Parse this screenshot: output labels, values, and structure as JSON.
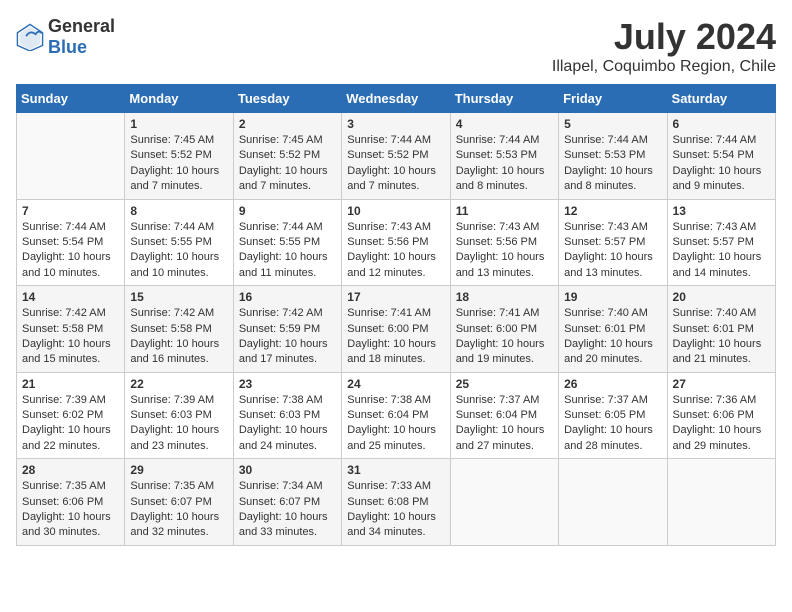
{
  "logo": {
    "general": "General",
    "blue": "Blue"
  },
  "title": {
    "month_year": "July 2024",
    "location": "Illapel, Coquimbo Region, Chile"
  },
  "days_of_week": [
    "Sunday",
    "Monday",
    "Tuesday",
    "Wednesday",
    "Thursday",
    "Friday",
    "Saturday"
  ],
  "weeks": [
    [
      {
        "day": "",
        "sunrise": "",
        "sunset": "",
        "daylight": ""
      },
      {
        "day": "1",
        "sunrise": "Sunrise: 7:45 AM",
        "sunset": "Sunset: 5:52 PM",
        "daylight": "Daylight: 10 hours and 7 minutes."
      },
      {
        "day": "2",
        "sunrise": "Sunrise: 7:45 AM",
        "sunset": "Sunset: 5:52 PM",
        "daylight": "Daylight: 10 hours and 7 minutes."
      },
      {
        "day": "3",
        "sunrise": "Sunrise: 7:44 AM",
        "sunset": "Sunset: 5:52 PM",
        "daylight": "Daylight: 10 hours and 7 minutes."
      },
      {
        "day": "4",
        "sunrise": "Sunrise: 7:44 AM",
        "sunset": "Sunset: 5:53 PM",
        "daylight": "Daylight: 10 hours and 8 minutes."
      },
      {
        "day": "5",
        "sunrise": "Sunrise: 7:44 AM",
        "sunset": "Sunset: 5:53 PM",
        "daylight": "Daylight: 10 hours and 8 minutes."
      },
      {
        "day": "6",
        "sunrise": "Sunrise: 7:44 AM",
        "sunset": "Sunset: 5:54 PM",
        "daylight": "Daylight: 10 hours and 9 minutes."
      }
    ],
    [
      {
        "day": "7",
        "sunrise": "Sunrise: 7:44 AM",
        "sunset": "Sunset: 5:54 PM",
        "daylight": "Daylight: 10 hours and 10 minutes."
      },
      {
        "day": "8",
        "sunrise": "Sunrise: 7:44 AM",
        "sunset": "Sunset: 5:55 PM",
        "daylight": "Daylight: 10 hours and 10 minutes."
      },
      {
        "day": "9",
        "sunrise": "Sunrise: 7:44 AM",
        "sunset": "Sunset: 5:55 PM",
        "daylight": "Daylight: 10 hours and 11 minutes."
      },
      {
        "day": "10",
        "sunrise": "Sunrise: 7:43 AM",
        "sunset": "Sunset: 5:56 PM",
        "daylight": "Daylight: 10 hours and 12 minutes."
      },
      {
        "day": "11",
        "sunrise": "Sunrise: 7:43 AM",
        "sunset": "Sunset: 5:56 PM",
        "daylight": "Daylight: 10 hours and 13 minutes."
      },
      {
        "day": "12",
        "sunrise": "Sunrise: 7:43 AM",
        "sunset": "Sunset: 5:57 PM",
        "daylight": "Daylight: 10 hours and 13 minutes."
      },
      {
        "day": "13",
        "sunrise": "Sunrise: 7:43 AM",
        "sunset": "Sunset: 5:57 PM",
        "daylight": "Daylight: 10 hours and 14 minutes."
      }
    ],
    [
      {
        "day": "14",
        "sunrise": "Sunrise: 7:42 AM",
        "sunset": "Sunset: 5:58 PM",
        "daylight": "Daylight: 10 hours and 15 minutes."
      },
      {
        "day": "15",
        "sunrise": "Sunrise: 7:42 AM",
        "sunset": "Sunset: 5:58 PM",
        "daylight": "Daylight: 10 hours and 16 minutes."
      },
      {
        "day": "16",
        "sunrise": "Sunrise: 7:42 AM",
        "sunset": "Sunset: 5:59 PM",
        "daylight": "Daylight: 10 hours and 17 minutes."
      },
      {
        "day": "17",
        "sunrise": "Sunrise: 7:41 AM",
        "sunset": "Sunset: 6:00 PM",
        "daylight": "Daylight: 10 hours and 18 minutes."
      },
      {
        "day": "18",
        "sunrise": "Sunrise: 7:41 AM",
        "sunset": "Sunset: 6:00 PM",
        "daylight": "Daylight: 10 hours and 19 minutes."
      },
      {
        "day": "19",
        "sunrise": "Sunrise: 7:40 AM",
        "sunset": "Sunset: 6:01 PM",
        "daylight": "Daylight: 10 hours and 20 minutes."
      },
      {
        "day": "20",
        "sunrise": "Sunrise: 7:40 AM",
        "sunset": "Sunset: 6:01 PM",
        "daylight": "Daylight: 10 hours and 21 minutes."
      }
    ],
    [
      {
        "day": "21",
        "sunrise": "Sunrise: 7:39 AM",
        "sunset": "Sunset: 6:02 PM",
        "daylight": "Daylight: 10 hours and 22 minutes."
      },
      {
        "day": "22",
        "sunrise": "Sunrise: 7:39 AM",
        "sunset": "Sunset: 6:03 PM",
        "daylight": "Daylight: 10 hours and 23 minutes."
      },
      {
        "day": "23",
        "sunrise": "Sunrise: 7:38 AM",
        "sunset": "Sunset: 6:03 PM",
        "daylight": "Daylight: 10 hours and 24 minutes."
      },
      {
        "day": "24",
        "sunrise": "Sunrise: 7:38 AM",
        "sunset": "Sunset: 6:04 PM",
        "daylight": "Daylight: 10 hours and 25 minutes."
      },
      {
        "day": "25",
        "sunrise": "Sunrise: 7:37 AM",
        "sunset": "Sunset: 6:04 PM",
        "daylight": "Daylight: 10 hours and 27 minutes."
      },
      {
        "day": "26",
        "sunrise": "Sunrise: 7:37 AM",
        "sunset": "Sunset: 6:05 PM",
        "daylight": "Daylight: 10 hours and 28 minutes."
      },
      {
        "day": "27",
        "sunrise": "Sunrise: 7:36 AM",
        "sunset": "Sunset: 6:06 PM",
        "daylight": "Daylight: 10 hours and 29 minutes."
      }
    ],
    [
      {
        "day": "28",
        "sunrise": "Sunrise: 7:35 AM",
        "sunset": "Sunset: 6:06 PM",
        "daylight": "Daylight: 10 hours and 30 minutes."
      },
      {
        "day": "29",
        "sunrise": "Sunrise: 7:35 AM",
        "sunset": "Sunset: 6:07 PM",
        "daylight": "Daylight: 10 hours and 32 minutes."
      },
      {
        "day": "30",
        "sunrise": "Sunrise: 7:34 AM",
        "sunset": "Sunset: 6:07 PM",
        "daylight": "Daylight: 10 hours and 33 minutes."
      },
      {
        "day": "31",
        "sunrise": "Sunrise: 7:33 AM",
        "sunset": "Sunset: 6:08 PM",
        "daylight": "Daylight: 10 hours and 34 minutes."
      },
      {
        "day": "",
        "sunrise": "",
        "sunset": "",
        "daylight": ""
      },
      {
        "day": "",
        "sunrise": "",
        "sunset": "",
        "daylight": ""
      },
      {
        "day": "",
        "sunrise": "",
        "sunset": "",
        "daylight": ""
      }
    ]
  ]
}
